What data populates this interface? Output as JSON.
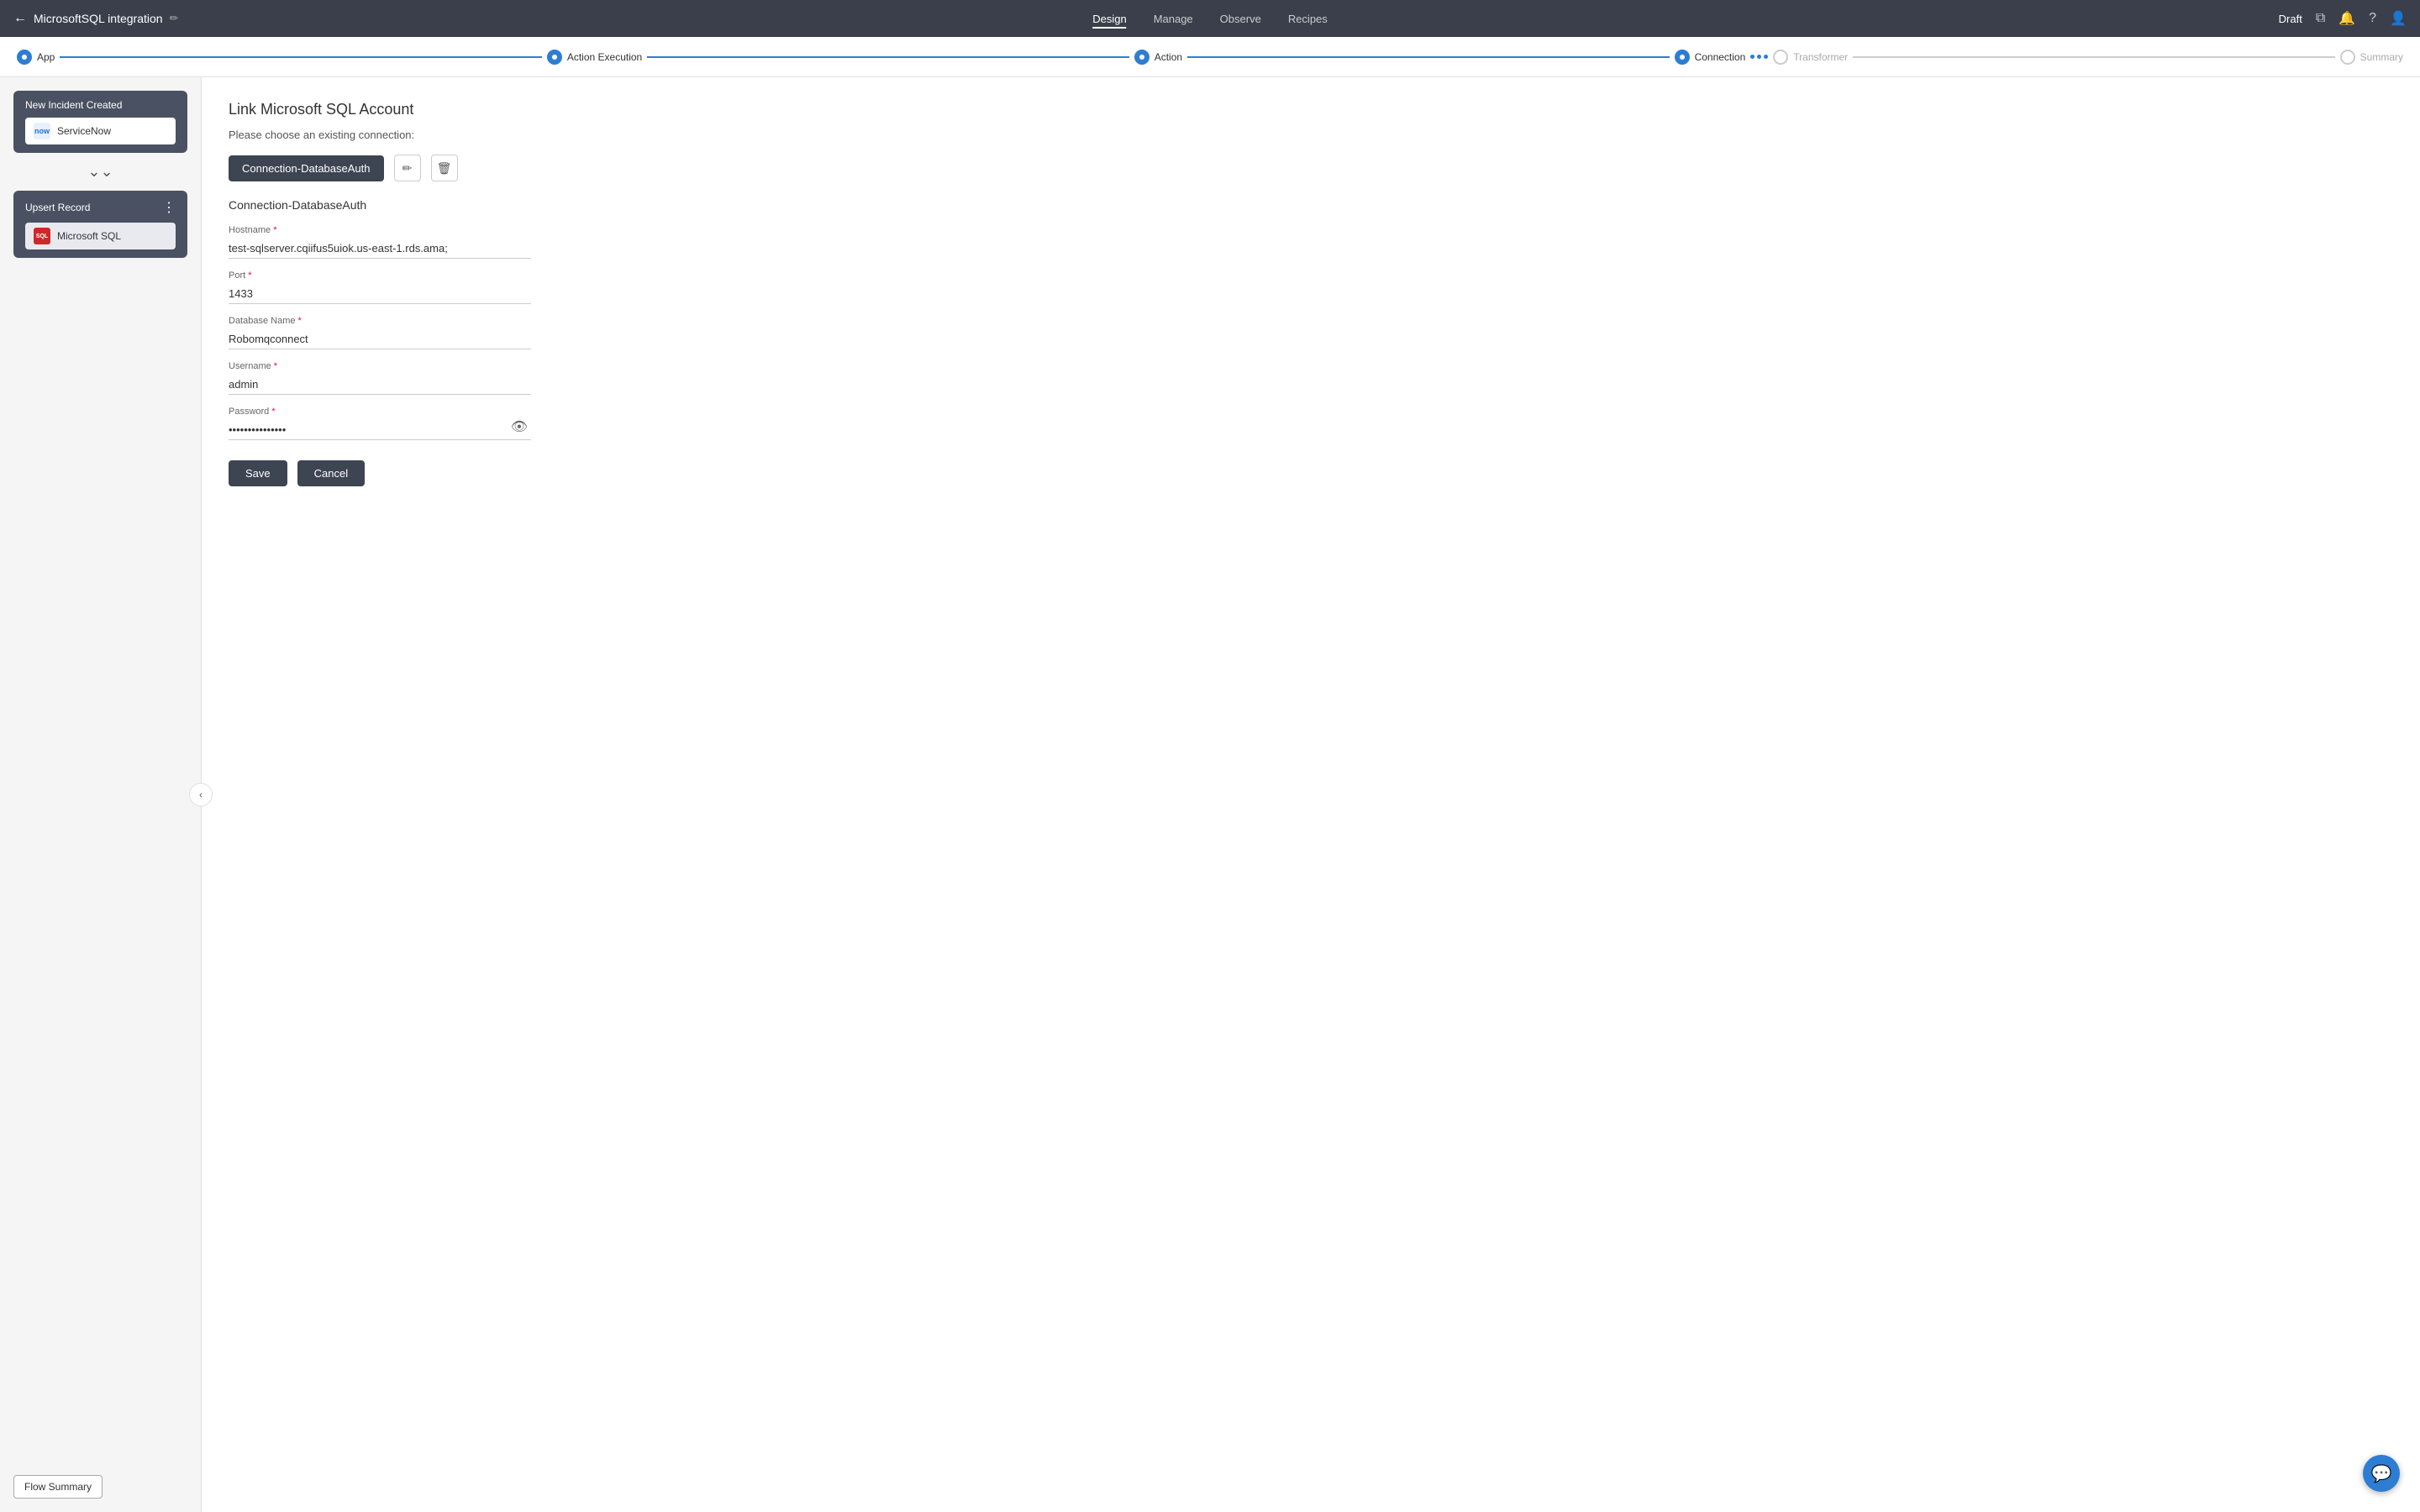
{
  "topNav": {
    "backLabel": "←",
    "title": "MicrosoftSQL integration",
    "editIcon": "✏",
    "navItems": [
      "Design",
      "Manage",
      "Observe",
      "Recipes"
    ],
    "activeNav": "Design",
    "draftLabel": "Draft",
    "icons": {
      "external": "⧉",
      "bell": "🔔",
      "help": "?",
      "user": "👤"
    }
  },
  "stepBar": {
    "steps": [
      {
        "label": "App",
        "state": "active"
      },
      {
        "label": "Action Execution",
        "state": "active"
      },
      {
        "label": "Action",
        "state": "active"
      },
      {
        "label": "Connection",
        "state": "active"
      },
      {
        "label": "Transformer",
        "state": "dots"
      },
      {
        "label": "Summary",
        "state": "inactive"
      }
    ]
  },
  "sidebar": {
    "flowCard": {
      "title": "New Incident Created",
      "service": "ServiceNow"
    },
    "chevronLabel": "⌄⌄",
    "actionCard": {
      "title": "Upsert Record",
      "service": "Microsoft SQL",
      "menuIcon": "⋮"
    },
    "collapseIcon": "‹",
    "flowSummaryLabel": "Flow Summary"
  },
  "mainContent": {
    "pageTitle": "Link Microsoft SQL Account",
    "chooseConnectionText": "Please choose an existing connection:",
    "connectionBtnLabel": "Connection-DatabaseAuth",
    "editIcon": "✏",
    "deleteIcon": "🗑",
    "sectionSubtitle": "Connection-DatabaseAuth",
    "fields": {
      "hostname": {
        "label": "Hostname",
        "required": true,
        "value": "test-sqlserver.cqiifus5uiok.us-east-1.rds.ama;"
      },
      "port": {
        "label": "Port",
        "required": true,
        "value": "1433"
      },
      "databaseName": {
        "label": "Database Name",
        "required": true,
        "value": "Robomqconnect"
      },
      "username": {
        "label": "Username",
        "required": true,
        "value": "admin"
      },
      "password": {
        "label": "Password",
        "required": true,
        "value": "••••••••••••"
      }
    },
    "saveLabel": "Save",
    "cancelLabel": "Cancel",
    "eyeIcon": "👁"
  },
  "chatBubble": {
    "icon": "💬"
  }
}
